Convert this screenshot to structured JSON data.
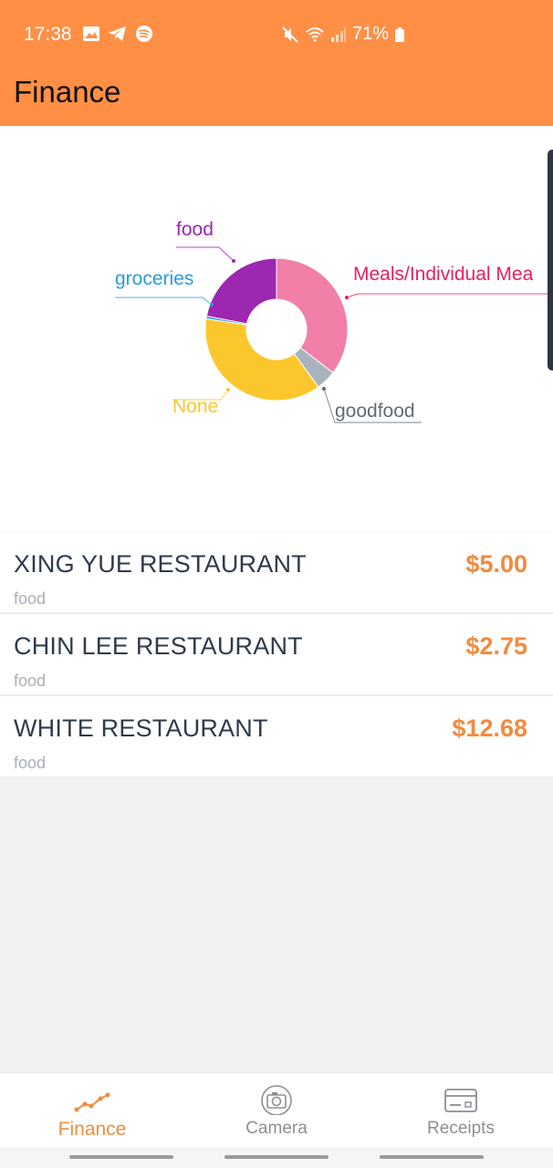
{
  "status_bar": {
    "time": "17:38",
    "battery": "71%",
    "left_icons": [
      "image-icon",
      "telegram-icon",
      "spotify-icon"
    ],
    "right_icons": [
      "mute-icon",
      "wifi-icon",
      "signal-icon",
      "battery-icon"
    ]
  },
  "header": {
    "title": "Finance"
  },
  "chart_data": {
    "type": "pie",
    "slices": [
      {
        "label": "Meals/Individual Mea",
        "value": 35.4,
        "color": "#f17fa8"
      },
      {
        "label": "goodfood",
        "value": 4.6,
        "color": "#a9b3bd"
      },
      {
        "label": "None",
        "value": 37.4,
        "color": "#fcc72c"
      },
      {
        "label": "groceries",
        "value": 0.6,
        "color": "#2a9ad8"
      },
      {
        "label": "food",
        "value": 22.0,
        "color": "#9c27b0"
      }
    ],
    "label_colors": {
      "food": "#9c27b0",
      "groceries": "#2a9ad8",
      "Meals/Individual Mea": "#e91e63",
      "None": "#fcc72c",
      "goodfood": "#5f6b77"
    }
  },
  "transactions": [
    {
      "name": "XING YUE RESTAURANT",
      "category": "food",
      "amount": "$5.00"
    },
    {
      "name": "CHIN LEE RESTAURANT",
      "category": "food",
      "amount": "$2.75"
    },
    {
      "name": "WHITE RESTAURANT",
      "category": "food",
      "amount": "$12.68"
    }
  ],
  "tabs": [
    {
      "label": "Finance",
      "icon": "trend-line-icon",
      "active": true
    },
    {
      "label": "Camera",
      "icon": "camera-icon",
      "active": false
    },
    {
      "label": "Receipts",
      "icon": "receipt-card-icon",
      "active": false
    }
  ],
  "colors": {
    "accent": "#ff8f45",
    "amount": "#f28b3d"
  }
}
